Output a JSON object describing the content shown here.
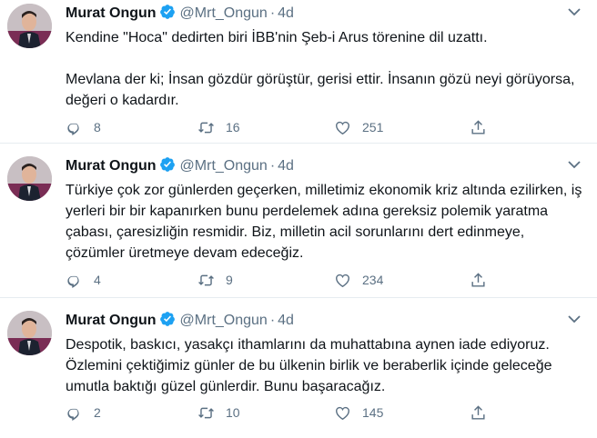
{
  "tweets": [
    {
      "name": "Murat Ongun",
      "handle": "@Mrt_Ongun",
      "separator": "·",
      "time": "4d",
      "text": "Kendine \"Hoca\" dedirten biri İBB'nin Şeb-i Arus törenine dil uzattı.\n\nMevlana der ki; İnsan gözdür görüştür, gerisi ettir. İnsanın gözü neyi görüyorsa, değeri o kadardır.",
      "replies": "8",
      "retweets": "16",
      "likes": "251"
    },
    {
      "name": "Murat Ongun",
      "handle": "@Mrt_Ongun",
      "separator": "·",
      "time": "4d",
      "text": "Türkiye çok zor günlerden geçerken, milletimiz ekonomik kriz altında ezilirken, iş yerleri bir bir kapanırken bunu perdelemek adına gereksiz polemik yaratma çabası, çaresizliğin resmidir. Biz, milletin acil sorunlarını dert edinmeye, çözümler üretmeye devam edeceğiz.",
      "replies": "4",
      "retweets": "9",
      "likes": "234"
    },
    {
      "name": "Murat Ongun",
      "handle": "@Mrt_Ongun",
      "separator": "·",
      "time": "4d",
      "text": "Despotik, baskıcı, yasakçı ithamlarını da muhattabına aynen iade ediyoruz. Özlemini çektiğimiz günler de bu ülkenin birlik ve beraberlik içinde geleceğe umutla baktığı güzel günlerdir. Bunu başaracağız.",
      "replies": "2",
      "retweets": "10",
      "likes": "145"
    }
  ],
  "colors": {
    "secondary": "#5b7083",
    "verified": "#1da1f2",
    "divider": "#e6ecf0"
  },
  "icons": [
    "more-icon",
    "verified-badge-icon",
    "reply-icon",
    "retweet-icon",
    "like-icon",
    "share-icon"
  ]
}
